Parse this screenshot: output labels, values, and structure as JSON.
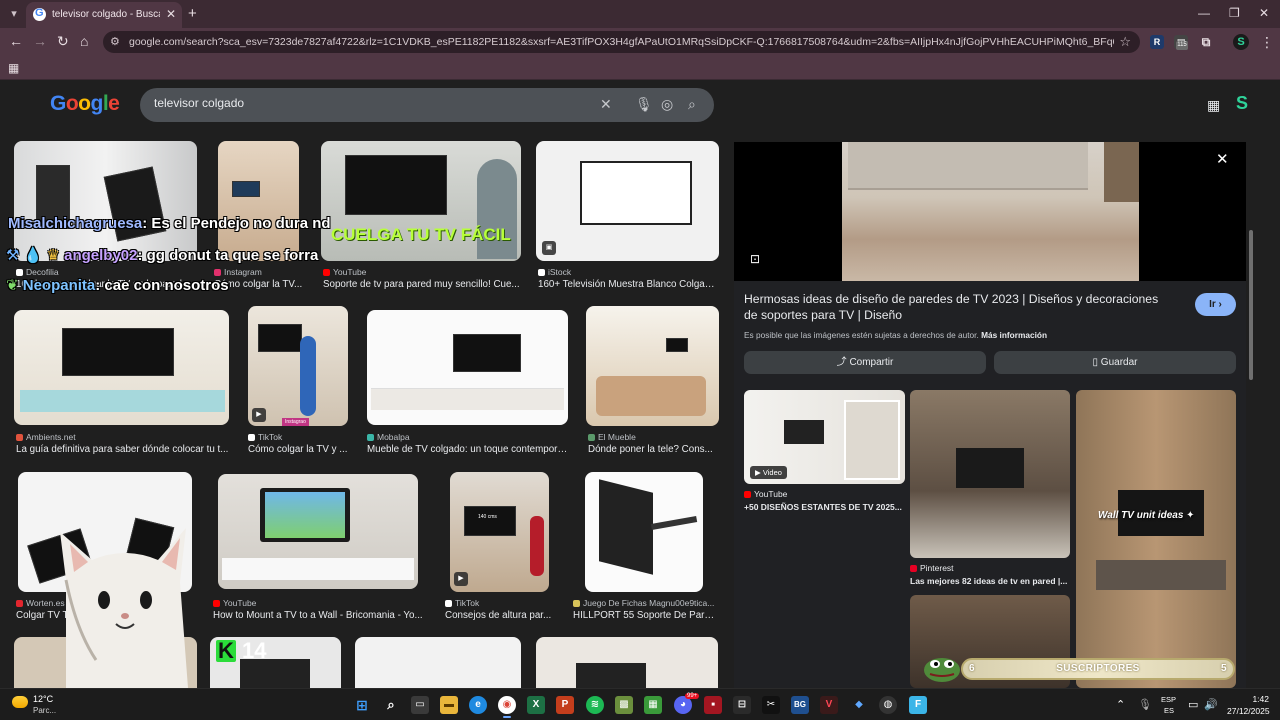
{
  "browser": {
    "tab_title": "televisor colgado - Buscar con Google",
    "url": "google.com/search?sca_esv=7323de7827af4722&rlz=1C1VDKB_esPE1182PE1182&sxsrf=AE3TifPOX3H4gfAPaUtO1MRqSsiDpCKF-Q:1766817508764&udm=2&fbs=AIIjpHx4nJjfGojPVHhEACUHPiMQht6_BFq6vBIoFFRK7qchKBv8IM7dq8ECq",
    "ext_badge": "115"
  },
  "google": {
    "logo": [
      "G",
      "o",
      "o",
      "g",
      "l",
      "e"
    ],
    "query": "televisor colgado"
  },
  "results": [
    {
      "source": "Decofilia",
      "caption": "10 ideas para colgar la TV en la pared",
      "source_color": "#ffffff"
    },
    {
      "source": "Instagram",
      "caption": "Cómo colgar la TV...",
      "source_color": "#e1306c"
    },
    {
      "source": "YouTube",
      "caption": "Soporte de tv para pared muy sencillo! Cue...",
      "source_color": "#ff0000"
    },
    {
      "source": "iStock",
      "caption": "160+ Televisión Muestra Blanco Colgad...",
      "source_color": "#ffffff"
    },
    {
      "source": "Ambients.net",
      "caption": "La guía definitiva para saber dónde colocar tu t...",
      "source_color": "#e0533d"
    },
    {
      "source": "TikTok",
      "caption": "Cómo colgar la TV y ...",
      "source_color": "#ffffff"
    },
    {
      "source": "Mobalpa",
      "caption": "Mueble de TV colgado: un toque contemporá...",
      "source_color": "#3bb6a8"
    },
    {
      "source": "El Mueble",
      "caption": "Dónde poner la tele? Cons...",
      "source_color": "#5b9a6b"
    },
    {
      "source": "Worten.es",
      "caption": "Colgar TV Techo",
      "source_color": "#e3262e"
    },
    {
      "source": "YouTube",
      "caption": "How to Mount a TV to a Wall - Bricomania - Yo...",
      "source_color": "#ff0000"
    },
    {
      "source": "TikTok",
      "caption": "Consejos de altura par...",
      "source_color": "#ffffff"
    },
    {
      "source": "Juego De Fichas Magnu00e9tica...",
      "caption": "HILLPORT 55 Soporte De Pare...",
      "source_color": "#d8c35a"
    }
  ],
  "thumb_text": {
    "youtube_overlay": "CUELGA TU TV FÁCIL",
    "tiktok_sticker": "Instagrao",
    "tiktok_measure": "140 cms"
  },
  "panel": {
    "title": "Hermosas ideas de diseño de paredes de TV 2023 | Diseños y decoraciones de soportes para TV | Diseño",
    "go_button": "Ir",
    "copyright": "Es posible que las imágenes estén sujetas a derechos de autor.",
    "more_info": "Más información",
    "share_button": "Compartir",
    "save_button": "Guardar",
    "related": [
      {
        "badge": "Video",
        "source": "YouTube",
        "caption": "+50 DISEÑOS ESTANTES DE TV 2025..."
      },
      {
        "source": "Pinterest",
        "caption": "Las mejores 82 ideas de tv en pared |..."
      },
      {
        "overlay": "Wall TV unit ideas"
      }
    ]
  },
  "overlay": {
    "chat": [
      {
        "user": "Misalchichagruesa",
        "message": ": Es el Pendejo no dura nd"
      },
      {
        "user": "angelby02",
        "message": ": gg donut ta que se forra"
      },
      {
        "user": "Neopanita",
        "message": ": cae con nosotros"
      }
    ],
    "k_counter": "14",
    "subs_label": "SUSCRIPTORES",
    "subs_left": "6",
    "subs_right": "5"
  },
  "taskbar": {
    "temp": "12°C",
    "weather": "Parc...",
    "lang_top": "ESP",
    "lang_bottom": "ES",
    "time": "1:42",
    "date": "27/12/2025",
    "app_badge": "99+"
  }
}
